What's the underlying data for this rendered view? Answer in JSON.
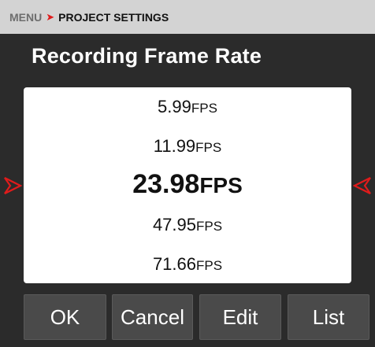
{
  "breadcrumb": {
    "menu": "MENU",
    "separator": "➤",
    "current": "PROJECT SETTINGS"
  },
  "title": "Recording Frame Rate",
  "picker": {
    "options": [
      {
        "value": "5.99",
        "unit": "FPS"
      },
      {
        "value": "11.99",
        "unit": "FPS"
      },
      {
        "value": "23.98",
        "unit": "FPS"
      },
      {
        "value": "47.95",
        "unit": "FPS"
      },
      {
        "value": "71.66",
        "unit": "FPS"
      }
    ],
    "selected_index": 2
  },
  "buttons": {
    "ok": "OK",
    "cancel": "Cancel",
    "edit": "Edit",
    "list": "List"
  },
  "colors": {
    "accent": "#e01b1b",
    "background": "#2b2b2b",
    "button": "#4a4a4a",
    "header": "#d3d3d3"
  }
}
